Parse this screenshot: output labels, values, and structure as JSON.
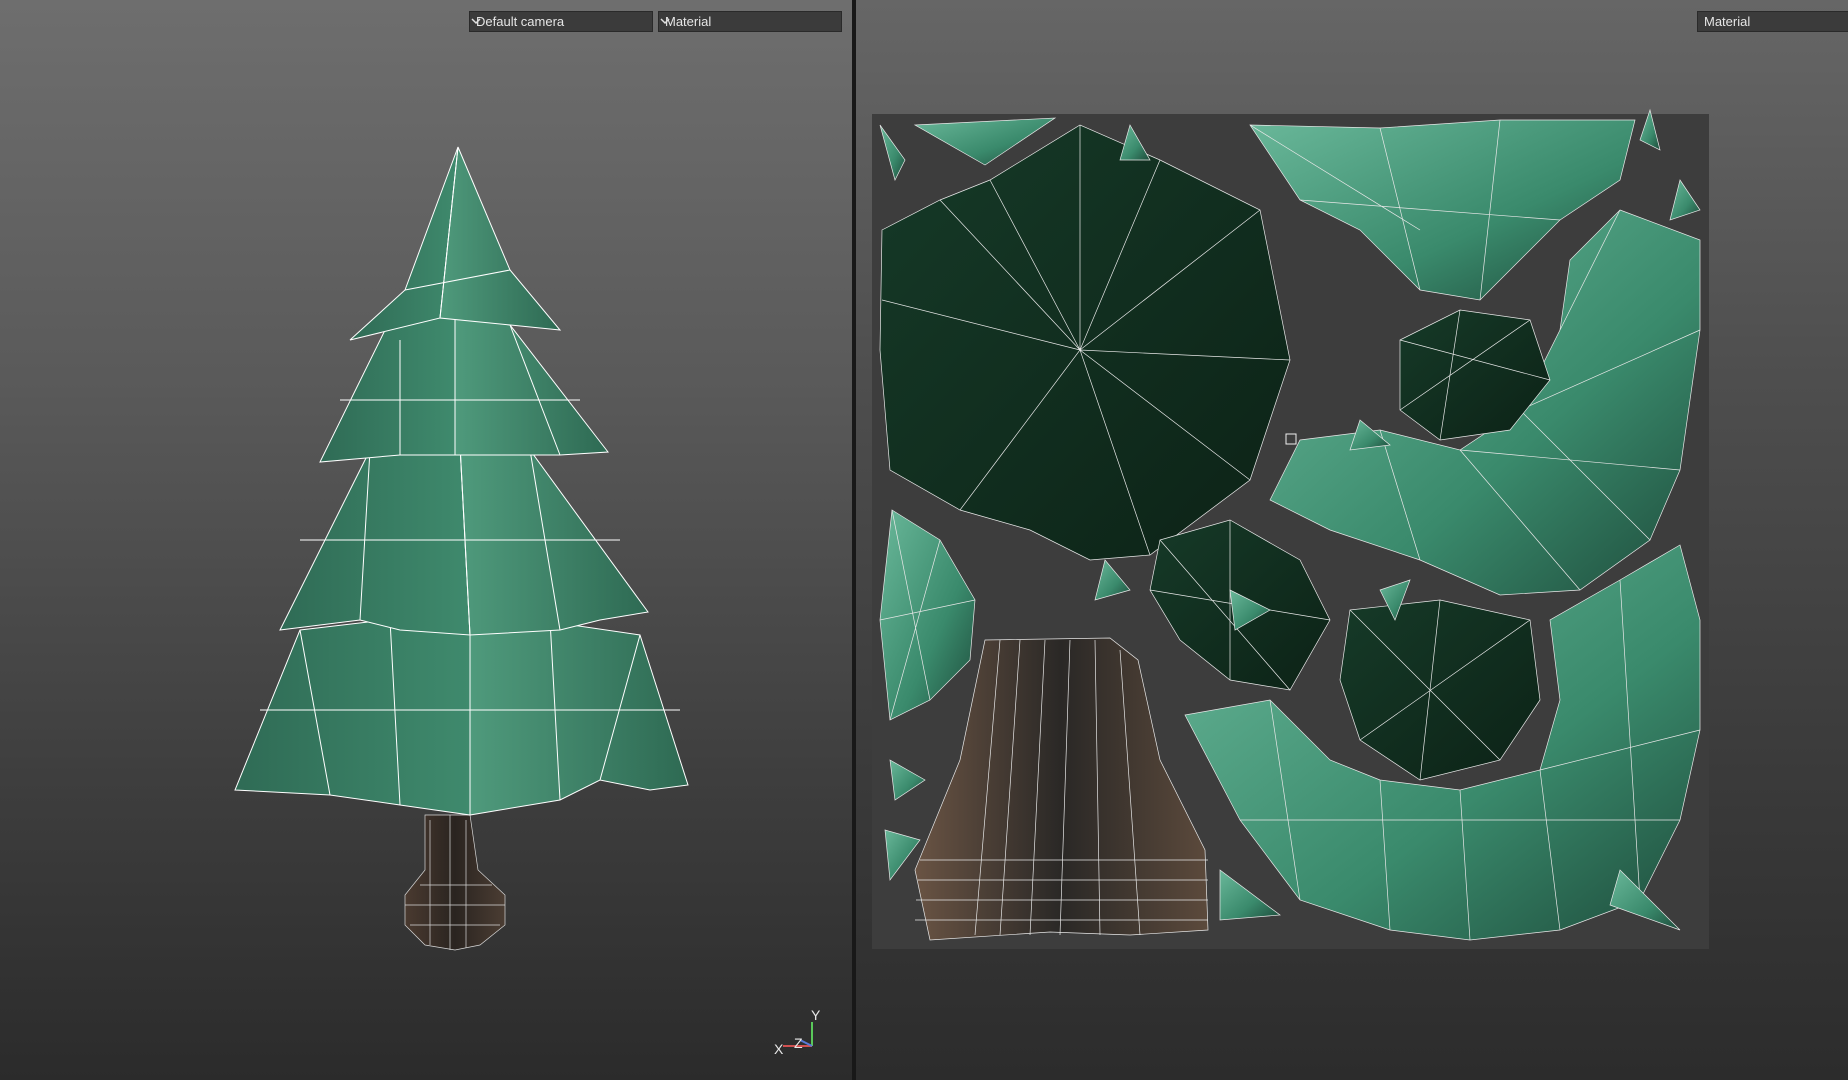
{
  "viewport_3d": {
    "camera_select": {
      "value": "Default camera"
    },
    "material_select": {
      "value": "Material"
    },
    "axis_gizmo": {
      "x_label": "X",
      "y_label": "Y",
      "z_label": "Z"
    }
  },
  "viewport_uv": {
    "material_select": {
      "value": "Material"
    }
  },
  "icons": {
    "dropdown": "chevron-down-icon",
    "gizmo": "axis-gizmo-icon"
  },
  "colors": {
    "foliage": "#3e8a6c",
    "foliage_dark": "#123020",
    "trunk": "#5a4a3e",
    "wire": "#ffffff",
    "uv_background": "#3d3d3d"
  }
}
